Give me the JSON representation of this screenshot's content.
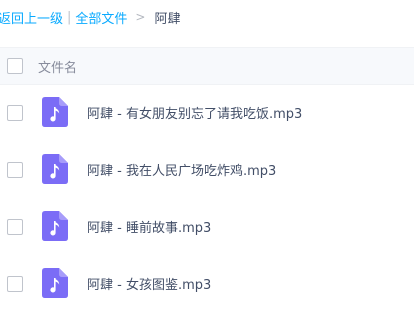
{
  "breadcrumb": {
    "back": "返回上一级",
    "separator": "|",
    "all_files": "全部文件",
    "arrow": ">",
    "current": "阿肆"
  },
  "list": {
    "column_name": "文件名",
    "files": [
      {
        "name": "阿肆 - 有女朋友别忘了请我吃饭.mp3",
        "icon": "music-file-icon"
      },
      {
        "name": "阿肆 - 我在人民广场吃炸鸡.mp3",
        "icon": "music-file-icon"
      },
      {
        "name": "阿肆 - 睡前故事.mp3",
        "icon": "music-file-icon"
      },
      {
        "name": "阿肆 - 女孩图鉴.mp3",
        "icon": "music-file-icon"
      }
    ]
  },
  "colors": {
    "link": "#09aaff",
    "icon_purple": "#7b6cf6",
    "header_bg": "#f7f9fc"
  }
}
